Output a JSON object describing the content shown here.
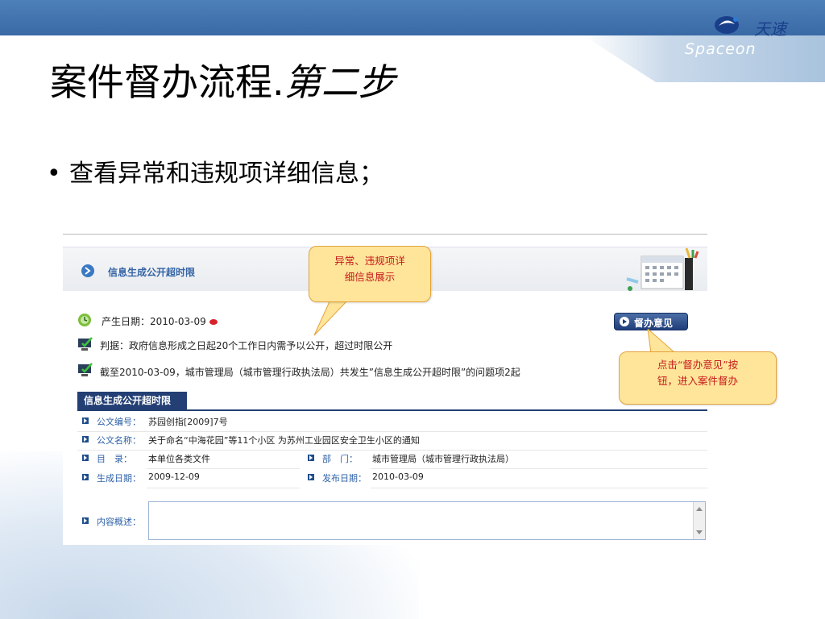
{
  "slide": {
    "title_main": "案件督办流程.",
    "title_italic": "第二步",
    "bullet_marker": "•",
    "bullet_text": "查看异常和违规项详细信息；"
  },
  "logo": {
    "cn": "天速",
    "en": "Spaceon"
  },
  "screenshot": {
    "header_label": "信息生成公开超时限",
    "date_label": "产生日期：",
    "date_value": "2010-03-09",
    "basis_text": "判据：政府信息形成之日起20个工作日内需予以公开，超过时限公开",
    "summary_text": "截至2010-03-09，城市管理局（城市管理行政执法局）共发生”信息生成公开超时限”的问题项2起",
    "duban_button": "督办意见",
    "tab_label": "信息生成公开超时限",
    "fields": {
      "doc_number_label": "公文编号：",
      "doc_number_value": "苏园创指[2009]7号",
      "doc_name_label": "公文名称：",
      "doc_name_value": "关于命名“中海花园”等11个小区 为苏州工业园区安全卫生小区的通知",
      "catalog_label": "目　录：",
      "catalog_value": "本单位各类文件",
      "dept_label": "部　门：",
      "dept_value": "城市管理局（城市管理行政执法局）",
      "gen_date_label": "生成日期：",
      "gen_date_value": "2009-12-09",
      "pub_date_label": "发布日期：",
      "pub_date_value": "2010-03-09",
      "summary_label": "内容概述："
    }
  },
  "callouts": {
    "first_line1": "异常、违规项详",
    "first_line2": "细信息展示",
    "second_line1": "点击“督办意见”按",
    "second_line2": "钮，进入案件督办"
  },
  "colors": {
    "top_bar": "#3a6aa6",
    "tab_bg": "#233f74",
    "callout_bg": "#ffe59a",
    "callout_text": "#c41a1a",
    "label_blue": "#2f62a8"
  }
}
